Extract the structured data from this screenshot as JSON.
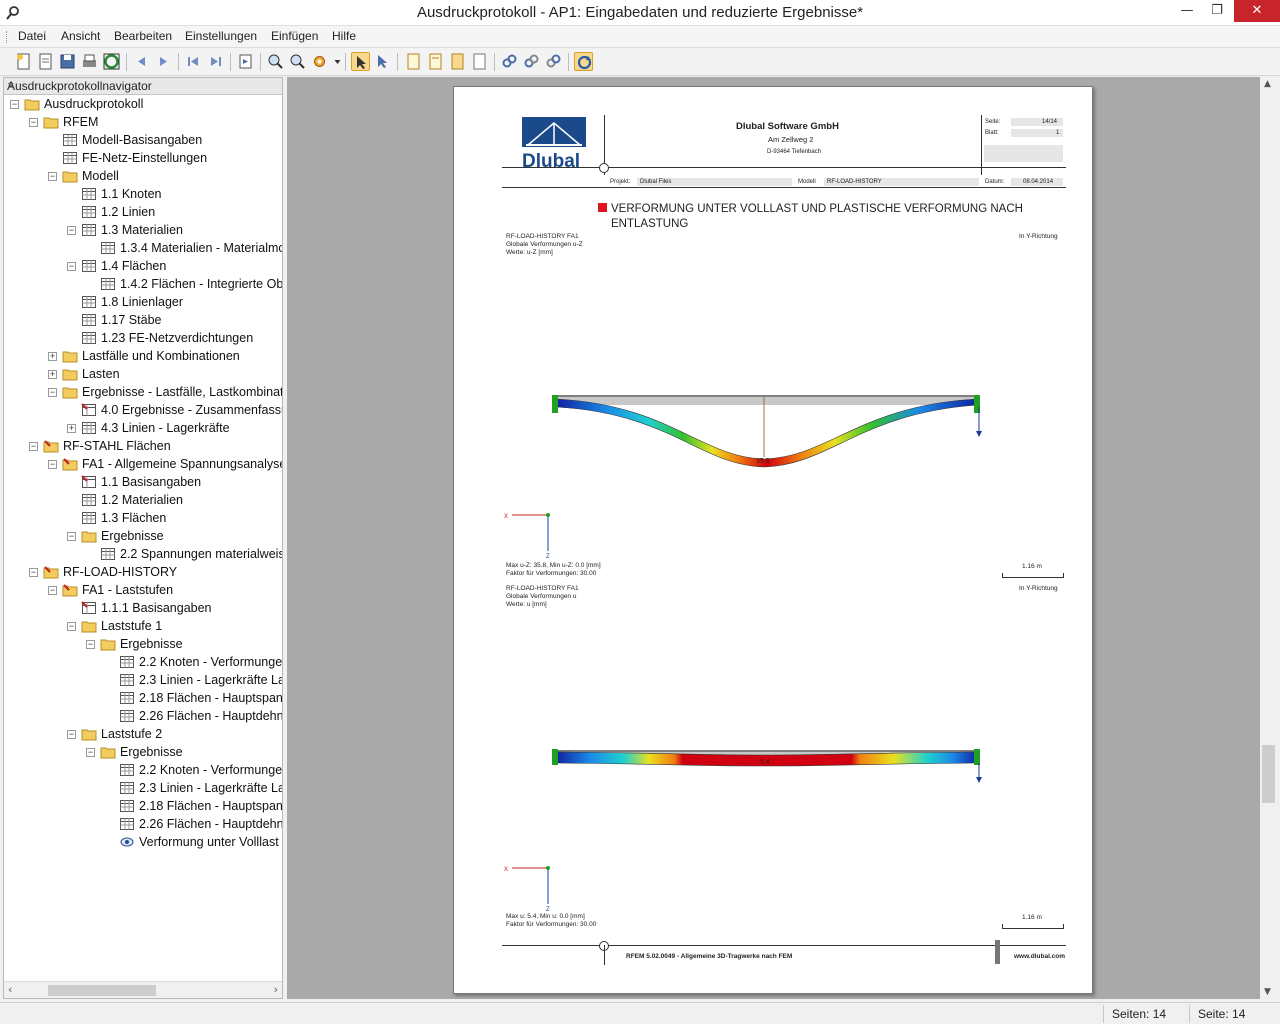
{
  "window": {
    "title": "Ausdruckprotokoll - AP1: Eingabedaten und reduzierte Ergebnisse*",
    "min_symbol": "—",
    "max_symbol": "❐",
    "close_symbol": "✕"
  },
  "menu": [
    "Datei",
    "Ansicht",
    "Bearbeiten",
    "Einstellungen",
    "Einfügen",
    "Hilfe"
  ],
  "navigator": {
    "title": "Ausdruckprotokollnavigator",
    "close_symbol": "×",
    "items": [
      {
        "label": "Ausdruckprotokoll",
        "icon": "folder-icon",
        "expander": "−"
      },
      {
        "label": "RFEM",
        "icon": "folder-icon",
        "expander": "−"
      },
      {
        "label": "Modell-Basisangaben",
        "icon": "table-icon",
        "expander": ""
      },
      {
        "label": "FE-Netz-Einstellungen",
        "icon": "table-icon",
        "expander": ""
      },
      {
        "label": "Modell",
        "icon": "folder-icon",
        "expander": "−"
      },
      {
        "label": "1.1 Knoten",
        "icon": "table-icon",
        "expander": ""
      },
      {
        "label": "1.2 Linien",
        "icon": "table-icon",
        "expander": ""
      },
      {
        "label": "1.3 Materialien",
        "icon": "table-icon",
        "expander": "−"
      },
      {
        "label": "1.3.4 Materialien - Materialmo",
        "icon": "table-icon",
        "expander": ""
      },
      {
        "label": "1.4 Flächen",
        "icon": "table-icon",
        "expander": "−"
      },
      {
        "label": "1.4.2 Flächen - Integrierte Obje",
        "icon": "table-icon",
        "expander": ""
      },
      {
        "label": "1.8 Linienlager",
        "icon": "table-icon",
        "expander": ""
      },
      {
        "label": "1.17 Stäbe",
        "icon": "table-icon",
        "expander": ""
      },
      {
        "label": "1.23 FE-Netzverdichtungen",
        "icon": "table-icon",
        "expander": ""
      },
      {
        "label": "Lastfälle und Kombinationen",
        "icon": "folder-icon",
        "expander": "+"
      },
      {
        "label": "Lasten",
        "icon": "folder-icon",
        "expander": "+"
      },
      {
        "label": "Ergebnisse - Lastfälle, Lastkombinatio",
        "icon": "folder-icon",
        "expander": "−"
      },
      {
        "label": "4.0 Ergebnisse - Zusammenfassun",
        "icon": "table-special-icon",
        "expander": ""
      },
      {
        "label": "4.3 Linien - Lagerkräfte",
        "icon": "table-icon",
        "expander": "+"
      },
      {
        "label": "RF-STAHL Flächen",
        "icon": "module-folder-icon",
        "expander": "−"
      },
      {
        "label": "FA1 - Allgemeine Spannungsanalyse v",
        "icon": "module-folder-icon",
        "expander": "−"
      },
      {
        "label": "1.1 Basisangaben",
        "icon": "table-special-icon",
        "expander": ""
      },
      {
        "label": "1.2 Materialien",
        "icon": "table-icon",
        "expander": ""
      },
      {
        "label": "1.3 Flächen",
        "icon": "table-icon",
        "expander": ""
      },
      {
        "label": "Ergebnisse",
        "icon": "folder-icon",
        "expander": "−"
      },
      {
        "label": "2.2 Spannungen materialweise",
        "icon": "table-icon",
        "expander": ""
      },
      {
        "label": "RF-LOAD-HISTORY",
        "icon": "module-folder-icon",
        "expander": "−"
      },
      {
        "label": "FA1 - Laststufen",
        "icon": "module-folder-icon",
        "expander": "−"
      },
      {
        "label": "1.1.1 Basisangaben",
        "icon": "table-special-icon",
        "expander": ""
      },
      {
        "label": "Laststufe 1",
        "icon": "folder-icon",
        "expander": "−"
      },
      {
        "label": "Ergebnisse",
        "icon": "folder-icon",
        "expander": "−"
      },
      {
        "label": "2.2 Knoten - Verformungen",
        "icon": "table-icon",
        "expander": ""
      },
      {
        "label": "2.3 Linien - Lagerkräfte Las",
        "icon": "table-icon",
        "expander": ""
      },
      {
        "label": "2.18 Flächen - Hauptspann",
        "icon": "table-icon",
        "expander": ""
      },
      {
        "label": "2.26 Flächen - Hauptdehnu",
        "icon": "table-icon",
        "expander": ""
      },
      {
        "label": "Laststufe 2",
        "icon": "folder-icon",
        "expander": "−"
      },
      {
        "label": "Ergebnisse",
        "icon": "folder-icon",
        "expander": "−"
      },
      {
        "label": "2.2 Knoten - Verformungen",
        "icon": "table-icon",
        "expander": ""
      },
      {
        "label": "2.3 Linien - Lagerkräfte Las",
        "icon": "table-icon",
        "expander": ""
      },
      {
        "label": "2.18 Flächen - Hauptspann",
        "icon": "table-icon",
        "expander": ""
      },
      {
        "label": "2.26 Flächen - Hauptdehnu",
        "icon": "table-icon",
        "expander": ""
      },
      {
        "label": "Verformung unter Volllast",
        "icon": "view-icon",
        "expander": ""
      }
    ]
  },
  "page": {
    "logo_text": "Dlubal",
    "company": "Dlubal Software GmbH",
    "street": "Am Zellweg 2",
    "city": "D-93464 Tiefenbach",
    "seite_label": "Seite:",
    "seite_value": "14/14",
    "blatt_label": "Blatt:",
    "blatt_value": "1",
    "projekt_label": "Projekt:",
    "projekt_value": "Dlubal Files",
    "modell_label": "Modell",
    "modell_value": "RF-LOAD-HISTORY",
    "datum_label": "Datum:",
    "datum_value": "08.04.2014",
    "section_title_1": "VERFORMUNG UNTER VOLLLAST UND PLASTISCHE VERFORMUNG NACH",
    "section_title_2": "ENTLASTUNG",
    "fig1": {
      "line1": "RF-LOAD-HISTORY FA1",
      "line2": "Globale Verformungen u-Z",
      "line3": "Werte: u-Z [mm]",
      "direction": "In Y-Richtung",
      "value_label": "35.8",
      "axis_x": "X",
      "axis_z": "Z",
      "max_text": "Max u-Z: 35.8, Min u-Z: 0.0 [mm]",
      "factor_text": "Faktor für Verformungen: 30.00",
      "scale_text": "1.16 m"
    },
    "fig2": {
      "line1": "RF-LOAD-HISTORY FA1",
      "line2": "Globale Verformungen u",
      "line3": "Werte: u [mm]",
      "direction": "In Y-Richtung",
      "value_label": "5.4",
      "axis_x": "X",
      "axis_z": "Z",
      "max_text": "Max u: 5.4, Min u: 0.0 [mm]",
      "factor_text": "Faktor für Verformungen: 30.00",
      "scale_text": "1.16 m"
    },
    "footer_text": "RFEM 5.02.0049 - Allgemeine 3D-Tragwerke nach FEM",
    "footer_url": "www.dlubal.com"
  },
  "status": {
    "pages_1": "Seiten: 14",
    "pages_2": "Seite: 14"
  },
  "colors": {
    "accent": "#f8d88c",
    "logo_blue": "#1a4a8a",
    "close_red": "#c7252b"
  }
}
